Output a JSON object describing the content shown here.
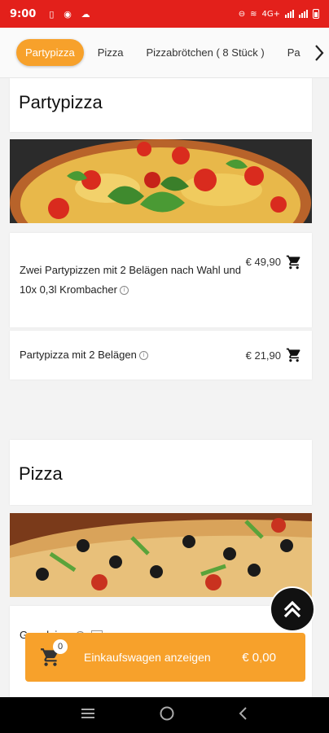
{
  "status_bar": {
    "time": "9:00",
    "network": "4G+"
  },
  "tabs": [
    {
      "label": "Partypizza",
      "active": true
    },
    {
      "label": "Pizza",
      "active": false
    },
    {
      "label": "Pizzabrötchen ( 8 Stück )",
      "active": false
    },
    {
      "label": "Pa",
      "active": false
    }
  ],
  "sections": [
    {
      "title": "Partypizza",
      "items": [
        {
          "description": "Zwei Partypizzen mit 2 Belägen nach Wahl und 10x 0,3l Krombacher",
          "price": "€ 49,90"
        },
        {
          "description": "Partypizza mit 2 Belägen",
          "price": "€ 21,90"
        }
      ]
    },
    {
      "title": "Pizza",
      "items": [
        {
          "description": "Grundpizza",
          "price": ""
        }
      ]
    }
  ],
  "cart": {
    "count": "0",
    "label": "Einkaufswagen anzeigen",
    "total": "€ 0,00"
  },
  "colors": {
    "status_bar": "#e3201b",
    "accent": "#f7a12b"
  }
}
